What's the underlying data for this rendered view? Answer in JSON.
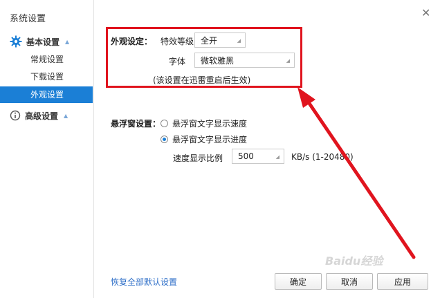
{
  "sidebar": {
    "title": "系统设置",
    "group_basic": {
      "label": "基本设置",
      "icon": "gear-icon"
    },
    "items": [
      {
        "label": "常规设置"
      },
      {
        "label": "下载设置"
      },
      {
        "label": "外观设置",
        "active": true
      }
    ],
    "group_advanced": {
      "label": "高级设置",
      "icon": "info-icon"
    }
  },
  "appearance": {
    "section_label": "外观设定：",
    "effects_label": "特效等级",
    "effects_value": "全开",
    "font_label": "字体",
    "font_value": "微软雅黑",
    "note": "(该设置在迅雷重启后生效)"
  },
  "float_window": {
    "section_label": "悬浮窗设置：",
    "option_speed": "悬浮窗文字显示速度",
    "option_progress": "悬浮窗文字显示进度",
    "selected": "progress",
    "ratio_label": "速度显示比例",
    "ratio_value": "500",
    "ratio_unit": "KB/s (1-20480)"
  },
  "footer": {
    "restore_link": "恢复全部默认设置",
    "ok": "确定",
    "cancel": "取消",
    "apply": "应用"
  },
  "watermark": "Baidu经验",
  "colors": {
    "accent": "#1b7fd6",
    "annotation": "#e0141e"
  }
}
